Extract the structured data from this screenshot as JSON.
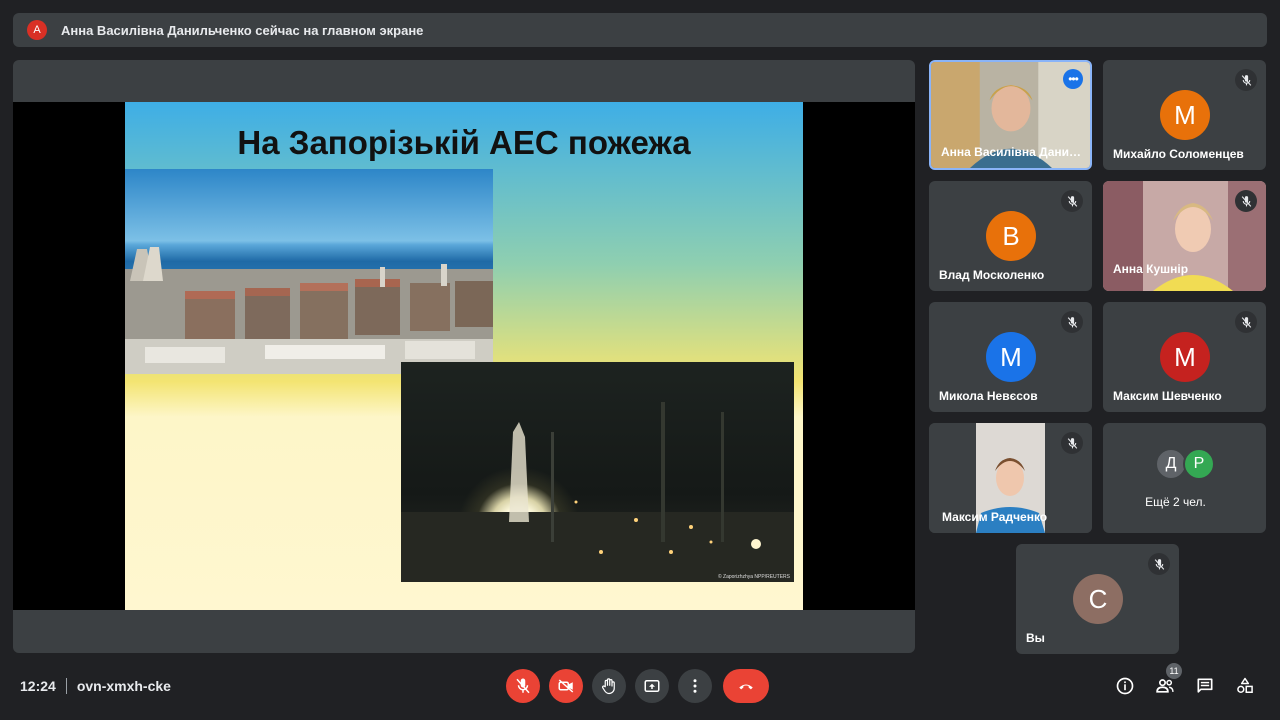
{
  "banner": {
    "avatar_letter": "А",
    "text": "Анна Василівна Данильченко сейчас на главном экране"
  },
  "slide": {
    "title": "На Запорізькій АЕС пожежа",
    "photo_credit": "© Zaporizhzhya NPP/REUTERS"
  },
  "participants": [
    {
      "name": "Анна Василівна Дани…",
      "type": "video",
      "active": true
    },
    {
      "name": "Михайло Соломенцев",
      "type": "avatar",
      "letter": "М",
      "color": "#e8710a"
    },
    {
      "name": "Влад Москоленко",
      "type": "avatar",
      "letter": "В",
      "color": "#e8710a"
    },
    {
      "name": "Анна Кушнір",
      "type": "video"
    },
    {
      "name": "Микола Невєсов",
      "type": "avatar",
      "letter": "М",
      "color": "#1a73e8"
    },
    {
      "name": "Максим Шевченко",
      "type": "avatar",
      "letter": "М",
      "color": "#c5221f"
    },
    {
      "name": "Максим Радченко",
      "type": "video"
    },
    {
      "name": "Ещё 2 чел.",
      "type": "group",
      "letters": [
        "Д",
        "Р"
      ],
      "colors": [
        "#5f6368",
        "#34a853"
      ]
    },
    {
      "name": "Вы",
      "type": "avatar",
      "letter": "С",
      "color": "#8d6e63"
    }
  ],
  "bottom": {
    "time": "12:24",
    "meeting_code": "ovn-xmxh-cke",
    "participant_count": "11"
  },
  "colors": {
    "danger": "#ea4335",
    "surface": "#3c4043",
    "background": "#202124",
    "accent": "#8ab4f8"
  }
}
